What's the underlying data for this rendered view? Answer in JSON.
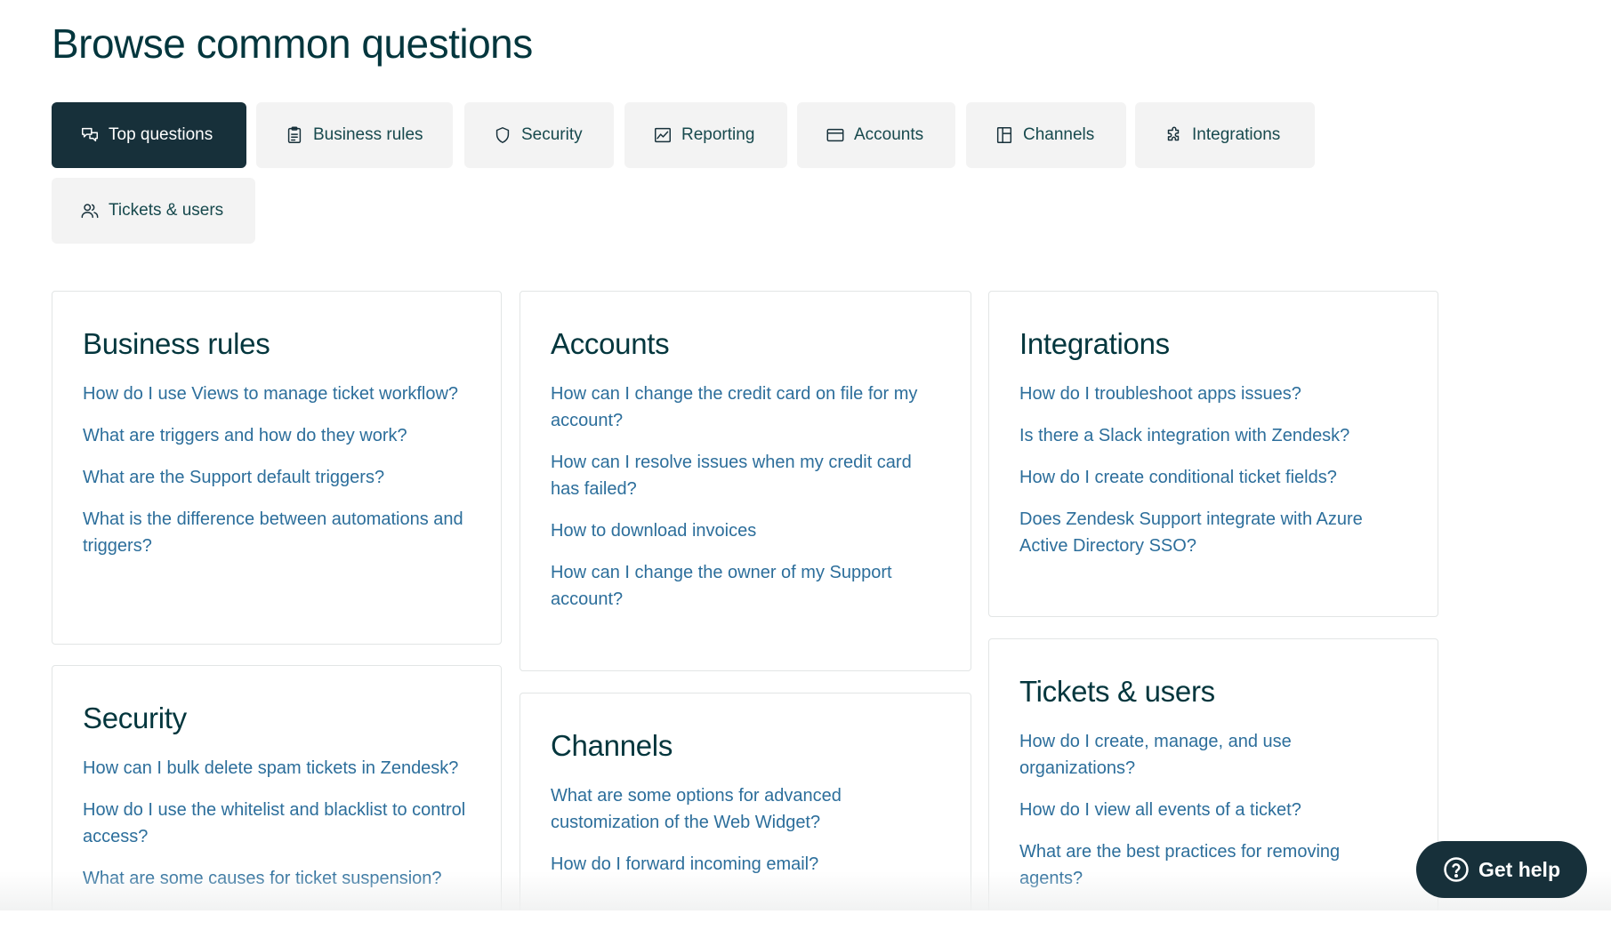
{
  "page": {
    "title": "Browse common questions"
  },
  "tabs": [
    {
      "label": "Top questions",
      "icon": "chat-bubbles-icon",
      "active": true
    },
    {
      "label": "Business rules",
      "icon": "clipboard-icon",
      "active": false
    },
    {
      "label": "Security",
      "icon": "shield-icon",
      "active": false
    },
    {
      "label": "Reporting",
      "icon": "chart-icon",
      "active": false
    },
    {
      "label": "Accounts",
      "icon": "credit-card-icon",
      "active": false
    },
    {
      "label": "Channels",
      "icon": "layout-icon",
      "active": false
    },
    {
      "label": "Integrations",
      "icon": "puzzle-icon",
      "active": false
    },
    {
      "label": "Tickets & users",
      "icon": "users-icon",
      "active": false
    }
  ],
  "cards": {
    "business_rules": {
      "title": "Business rules",
      "links": [
        "How do I use Views to manage ticket workflow?",
        "What are triggers and how do they work?",
        "What are the Support default triggers?",
        "What is the difference between automations and triggers?"
      ]
    },
    "security": {
      "title": "Security",
      "links": [
        "How can I bulk delete spam tickets in Zendesk?",
        "How do I use the whitelist and blacklist to control access?",
        "What are some causes for ticket suspension?"
      ]
    },
    "accounts": {
      "title": "Accounts",
      "links": [
        "How can I change the credit card on file for my account?",
        "How can I resolve issues when my credit card has failed?",
        "How to download invoices",
        "How can I change the owner of my Support account?"
      ]
    },
    "channels": {
      "title": "Channels",
      "links": [
        "What are some options for advanced customization of the Web Widget?",
        "How do I forward incoming email?"
      ]
    },
    "integrations": {
      "title": "Integrations",
      "links": [
        "How do I troubleshoot apps issues?",
        "Is there a Slack integration with Zendesk?",
        "How do I create conditional ticket fields?",
        "Does Zendesk Support integrate with Azure Active Directory SSO?"
      ]
    },
    "tickets_users": {
      "title": "Tickets & users",
      "links": [
        "How do I create, manage, and use organizations?",
        "How do I view all events of a ticket?",
        "What are the best practices for removing agents?"
      ]
    }
  },
  "help_button": {
    "label": "Get help",
    "icon": "question-circle-icon"
  },
  "colors": {
    "active_tab_bg": "#17303a",
    "tab_bg": "#f3f3f3",
    "link": "#2c6e9b",
    "heading": "#03363d"
  }
}
